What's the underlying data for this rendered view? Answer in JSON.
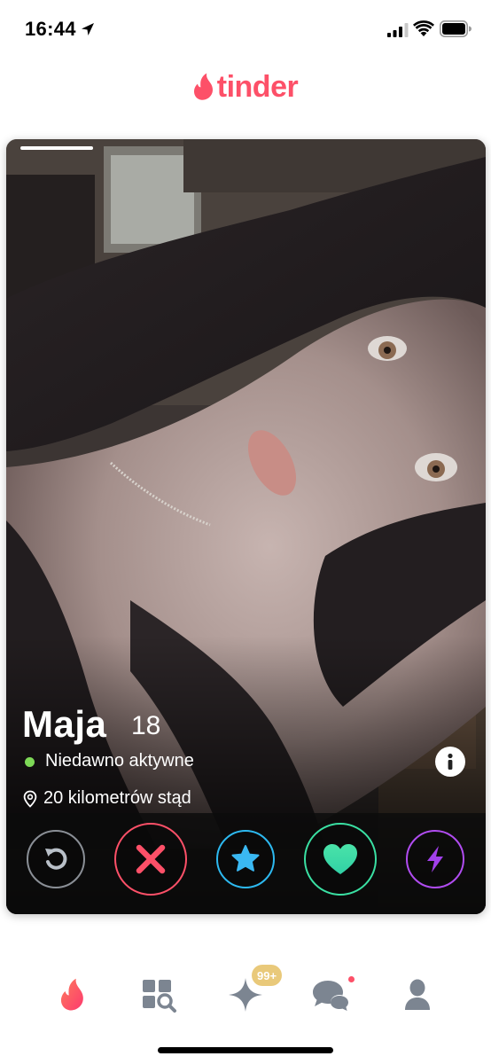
{
  "status_bar": {
    "time": "16:44",
    "icons": [
      "location-arrow-icon",
      "cellular-signal-icon",
      "wifi-icon",
      "battery-icon"
    ]
  },
  "brand": {
    "wordmark": "tinder",
    "color": "#fd5068"
  },
  "card": {
    "photo_index": 1,
    "photo_count": 1,
    "name": "Maja",
    "age": "18",
    "activity": "Niedawno aktywne",
    "distance": "20 kilometrów stąd",
    "info_icon": "info-icon"
  },
  "actions": [
    {
      "name": "rewind",
      "icon": "rewind-icon",
      "color": "#8a8f96"
    },
    {
      "name": "nope",
      "icon": "close-icon",
      "color": "#fd5068"
    },
    {
      "name": "super-like",
      "icon": "star-icon",
      "color": "#2db9f0"
    },
    {
      "name": "like",
      "icon": "heart-icon",
      "color": "#3ae0a3"
    },
    {
      "name": "boost",
      "icon": "lightning-icon",
      "color": "#b04cf0"
    }
  ],
  "bottom_nav": {
    "items": [
      {
        "name": "home",
        "icon": "flame-icon",
        "active": true
      },
      {
        "name": "explore",
        "icon": "explore-grid-icon",
        "active": false
      },
      {
        "name": "gold-home",
        "icon": "sparkle-icon",
        "active": false
      },
      {
        "name": "messages",
        "icon": "chat-bubbles-icon",
        "active": false
      },
      {
        "name": "profile",
        "icon": "person-icon",
        "active": false
      }
    ],
    "gold_badge": "99+",
    "messages_unread": true
  },
  "colors": {
    "accent": "#fd5068",
    "active_dot": "#7ed957",
    "gold": "#e9c97a",
    "nav_inactive": "#7c8591"
  }
}
